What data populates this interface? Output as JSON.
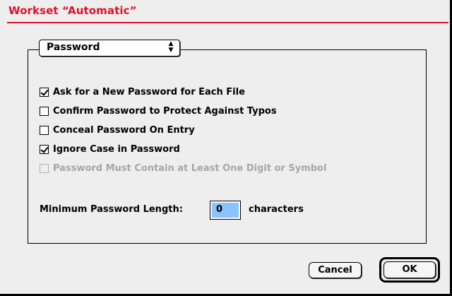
{
  "window": {
    "title": "Workset “Automatic”",
    "accent_color": "#e0102a"
  },
  "popup": {
    "selected": "Password",
    "arrow_up": "▲",
    "arrow_down": "▼"
  },
  "options": [
    {
      "label": "Ask for a New Password for Each File",
      "checked": true,
      "enabled": true
    },
    {
      "label": "Confirm Password to Protect Against Typos",
      "checked": false,
      "enabled": true
    },
    {
      "label": "Conceal Password On Entry",
      "checked": false,
      "enabled": true
    },
    {
      "label": "Ignore Case in Password",
      "checked": true,
      "enabled": true
    },
    {
      "label": "Password Must Contain at Least One Digit or Symbol",
      "checked": false,
      "enabled": false
    }
  ],
  "min_length": {
    "label": "Minimum Password Length:",
    "value": "0",
    "unit": "characters",
    "highlight_color": "#8ac4ff"
  },
  "buttons": {
    "cancel": "Cancel",
    "ok": "OK"
  }
}
